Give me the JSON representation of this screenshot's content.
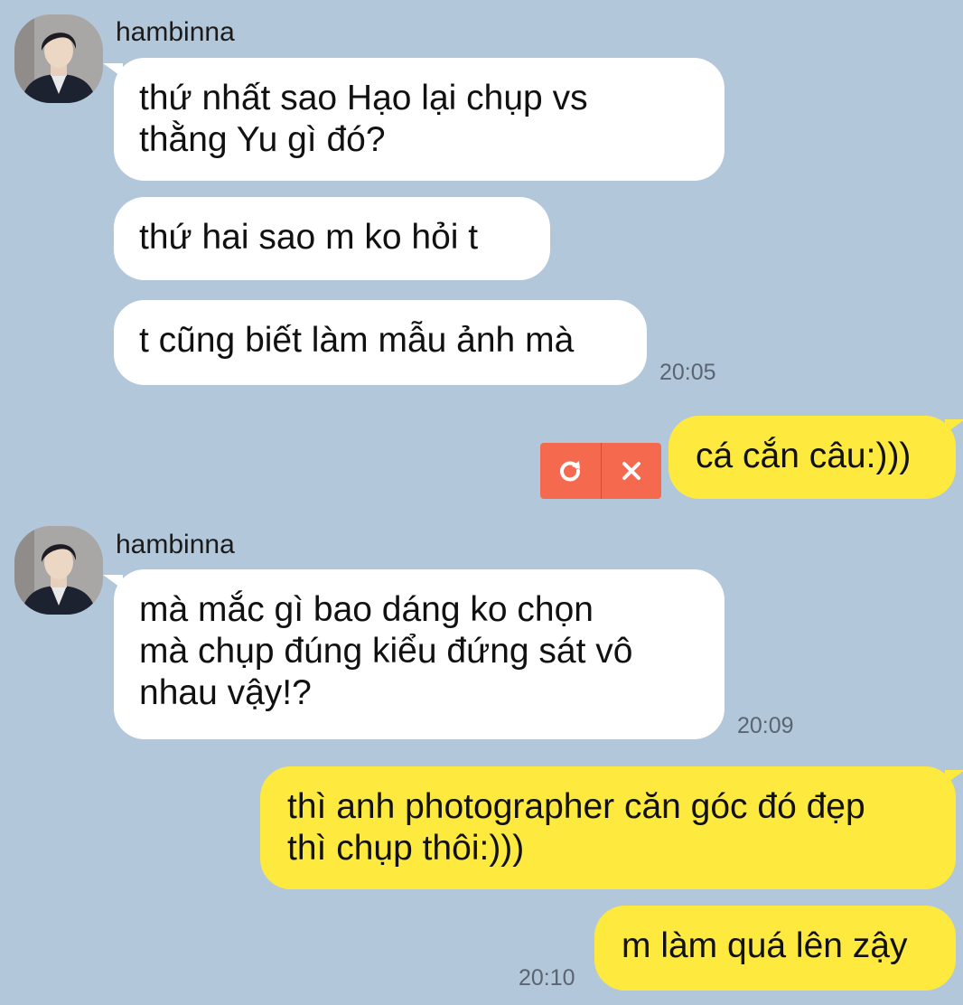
{
  "chat": {
    "sender_name": "hambinna",
    "groups": [
      {
        "sender": "hambinna",
        "messages": [
          {
            "lines": [
              "thứ nhất sao Hạo lại chụp vs",
              "thằng Yu gì đó?"
            ]
          },
          {
            "lines": [
              "thứ hai sao m ko hỏi t"
            ]
          },
          {
            "lines": [
              "t cũng biết làm mẫu ảnh mà"
            ],
            "time": "20:05"
          }
        ]
      },
      {
        "sender": "me",
        "messages": [
          {
            "lines": [
              "cá cắn câu:)))"
            ],
            "status": "failed"
          }
        ]
      },
      {
        "sender": "hambinna",
        "messages": [
          {
            "lines": [
              "mà mắc gì bao dáng ko chọn",
              "mà chụp đúng kiểu đứng sát vô",
              "nhau vậy!?"
            ],
            "time": "20:09"
          }
        ]
      },
      {
        "sender": "me",
        "messages": [
          {
            "lines": [
              "thì anh photographer căn góc đó đẹp",
              "thì chụp thôi:)))"
            ]
          },
          {
            "lines": [
              "m làm quá lên zậy"
            ],
            "time": "20:10"
          }
        ]
      }
    ],
    "failed_actions": {
      "retry_icon": "retry-icon",
      "delete_icon": "close-icon"
    }
  },
  "colors": {
    "background": "#b3c7db",
    "incoming_bubble": "#ffffff",
    "outgoing_bubble": "#fee93f",
    "failed_box": "#f56a4f",
    "timestamp": "#5a6571"
  }
}
